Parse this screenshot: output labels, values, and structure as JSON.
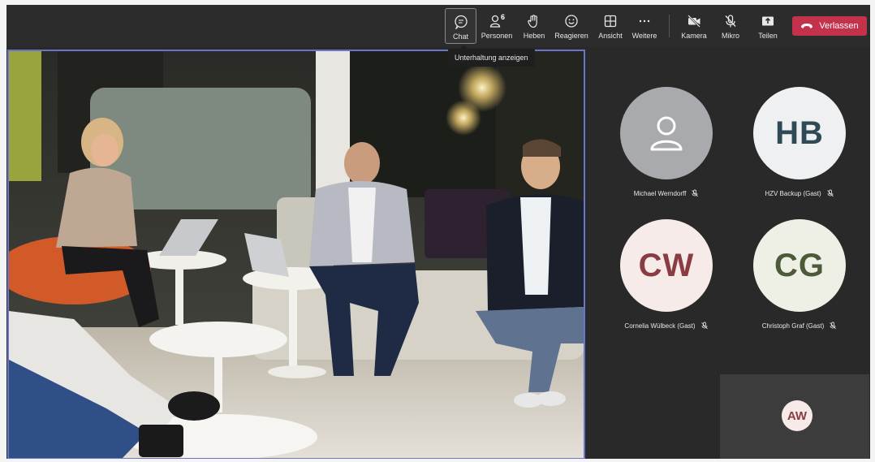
{
  "toolbar": {
    "chat": {
      "label": "Chat",
      "icon": "chat-icon"
    },
    "people": {
      "label": "Personen",
      "count": "6",
      "icon": "people-icon"
    },
    "raise": {
      "label": "Heben",
      "icon": "hand-icon"
    },
    "react": {
      "label": "Reagieren",
      "icon": "smiley-icon"
    },
    "view": {
      "label": "Ansicht",
      "icon": "grid-icon"
    },
    "more": {
      "label": "Weitere",
      "icon": "ellipsis-icon"
    },
    "camera": {
      "label": "Kamera",
      "icon": "camera-off-icon"
    },
    "mic": {
      "label": "Mikro",
      "icon": "mic-off-icon"
    },
    "share": {
      "label": "Teilen",
      "icon": "share-icon"
    },
    "leave": {
      "label": "Verlassen",
      "icon": "phone-hangup-icon"
    }
  },
  "tooltip": {
    "text": "Unterhaltung anzeigen"
  },
  "participants": [
    {
      "name": "Michael Werndorff",
      "initials": "",
      "avatar": "person-icon",
      "muted": true
    },
    {
      "name": "HZV Backup (Gast)",
      "initials": "HB",
      "muted": true
    },
    {
      "name": "Cornelia Wülbeck (Gast)",
      "initials": "CW",
      "muted": true
    },
    {
      "name": "Christoph Graf (Gast)",
      "initials": "CG",
      "muted": true
    }
  ],
  "self": {
    "initials": "AW"
  },
  "colors": {
    "leave_red": "#c4314b",
    "active_border": "#6a75c8",
    "hb_text": "#2f4a55",
    "cw_text": "#8a3c44",
    "cg_text": "#4c5a3a"
  }
}
